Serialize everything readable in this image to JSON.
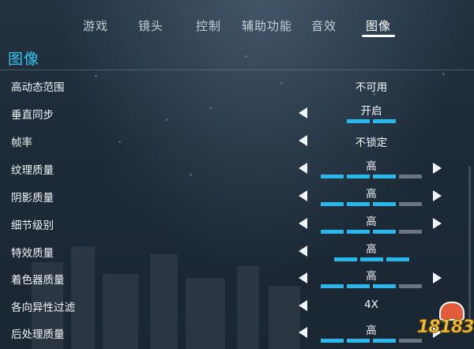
{
  "tabs": [
    {
      "label": "游戏"
    },
    {
      "label": "镜头"
    },
    {
      "label": "控制"
    },
    {
      "label": "辅助功能"
    },
    {
      "label": "音效"
    },
    {
      "label": "图像"
    }
  ],
  "active_tab": "图像",
  "section": {
    "title": "图像"
  },
  "settings": [
    {
      "label": "高动态范围",
      "value": "不可用"
    },
    {
      "label": "垂直同步",
      "value": "开启",
      "segments_total": 2,
      "segments_on": 2
    },
    {
      "label": "帧率",
      "value": "不锁定"
    },
    {
      "label": "纹理质量",
      "value": "高",
      "segments_total": 4,
      "segments_on": 3
    },
    {
      "label": "阴影质量",
      "value": "高",
      "segments_total": 4,
      "segments_on": 3
    },
    {
      "label": "细节级别",
      "value": "高",
      "segments_total": 4,
      "segments_on": 3
    },
    {
      "label": "特效质量",
      "value": "高",
      "segments_total": 3,
      "segments_on": 3
    },
    {
      "label": "着色器质量",
      "value": "高",
      "segments_total": 4,
      "segments_on": 3
    },
    {
      "label": "各向异性过滤",
      "value": "4X"
    },
    {
      "label": "后处理质量",
      "value": "高",
      "segments_total": 4,
      "segments_on": 3
    }
  ],
  "watermark": {
    "text": "18183"
  },
  "colors": {
    "accent": "#35c6f0",
    "segment_on": "#29b8ec",
    "segment_off": "#6c7680"
  }
}
